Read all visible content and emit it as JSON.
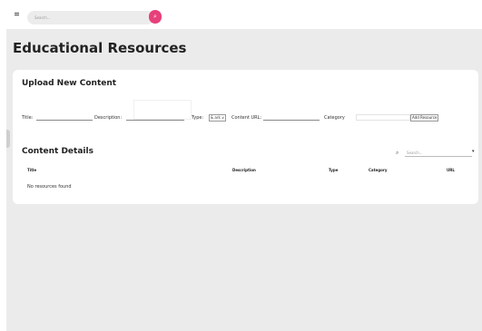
{
  "topbar": {
    "search_placeholder": "Search...",
    "search_button_glyph": "⌕"
  },
  "page": {
    "title": "Educational Resources"
  },
  "upload": {
    "title": "Upload New Content",
    "title_label": "Title:",
    "description_label": "Description:",
    "type_label": "Type:",
    "type_value": "& ark ∨",
    "url_label": "Content URL:",
    "category_label": "Category",
    "add_button": "Add Resource"
  },
  "details": {
    "title": "Content Details",
    "filter_placeholder": "Search...",
    "columns": [
      "Title",
      "Description",
      "Type",
      "Category",
      "URL"
    ],
    "empty_message": "No resources found"
  },
  "icons": {
    "menu": "menu-icon",
    "search": "search-icon",
    "filter_search": "search-icon",
    "caret": "caret-down-icon"
  },
  "colors": {
    "accent": "#e6407a",
    "background": "#ebebeb",
    "card": "#ffffff"
  }
}
